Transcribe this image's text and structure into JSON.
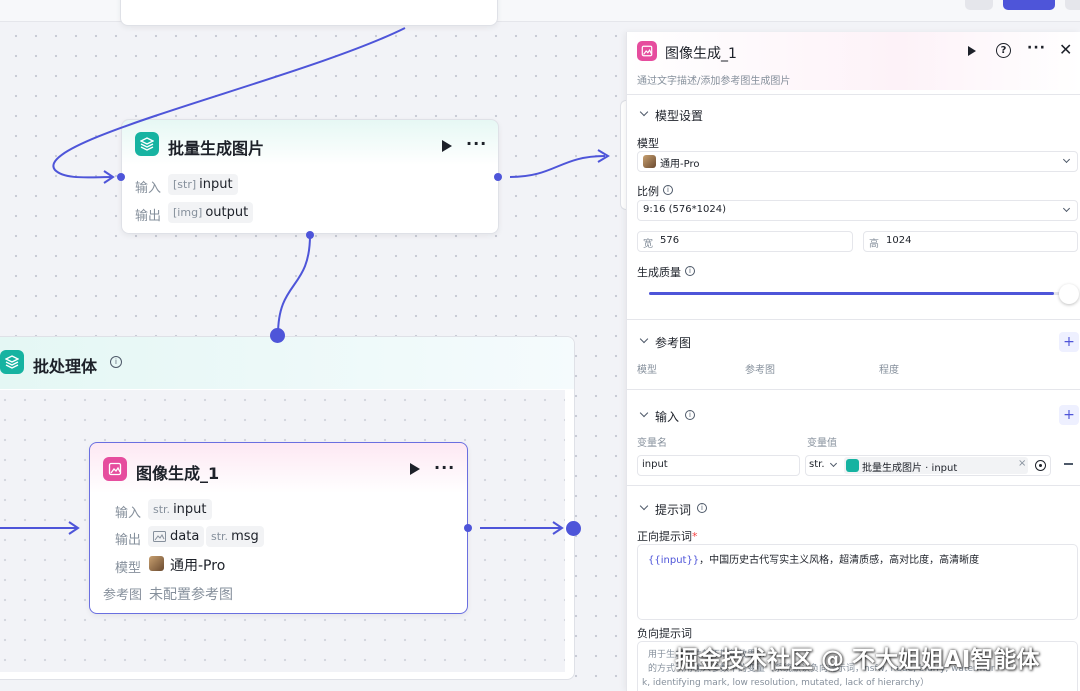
{
  "colors": {
    "accent": "#4e55d9",
    "teal": "#16b3a1",
    "pink": "#e64d9e"
  },
  "batch_image_node": {
    "title": "批量生成图片",
    "input_label": "输入",
    "output_label": "输出",
    "input_type": "[str]",
    "input_name": "input",
    "output_type": "[img]",
    "output_name": "output"
  },
  "batch_processor": {
    "title": "批处理体"
  },
  "image_gen_node": {
    "title": "图像生成_1",
    "input_label": "输入",
    "output_label": "输出",
    "model_label": "模型",
    "ref_label": "参考图",
    "input_type": "str.",
    "input_name": "input",
    "out1_name": "data",
    "out2_type": "str.",
    "out2_name": "msg",
    "model_name": "通用-Pro",
    "ref_value": "未配置参考图"
  },
  "panel": {
    "title": "图像生成_1",
    "subtitle": "通过文字描述/添加参考图生成图片",
    "model_settings": {
      "title": "模型设置",
      "model_label": "模型",
      "model_value": "通用-Pro",
      "ratio_label": "比例",
      "ratio_value": "9:16 (576*1024)",
      "width_label": "宽",
      "width_value": "576",
      "height_label": "高",
      "height_value": "1024",
      "quality_label": "生成质量",
      "quality_level": 0.97
    },
    "reference": {
      "title": "参考图",
      "col_model": "模型",
      "col_ref": "参考图",
      "col_degree": "程度"
    },
    "input": {
      "title": "输入",
      "col_name": "变量名",
      "col_value": "变量值",
      "var_name": "input",
      "var_type": "str.",
      "var_ref": "批量生成图片 · input"
    },
    "prompt": {
      "title": "提示词",
      "positive_label": "正向提示词",
      "positive_var": "{{input}}",
      "positive_text": "，中国历史古代写实主义风格，超清质感，高对比度，高清晰度",
      "negative_label": "负向提示词",
      "negative_text_1": "用于生成图片的不期望效果…",
      "negative_text_2": "的方式引用输入参数中的变量（系统默认负向提示词，nsfw, nude, blurry, watermar",
      "negative_text_3": "k, identifying mark, low resolution, mutated, lack of hierarchy）"
    }
  },
  "watermark": "掘金技术社区 @ 不大姐姐AI智能体"
}
